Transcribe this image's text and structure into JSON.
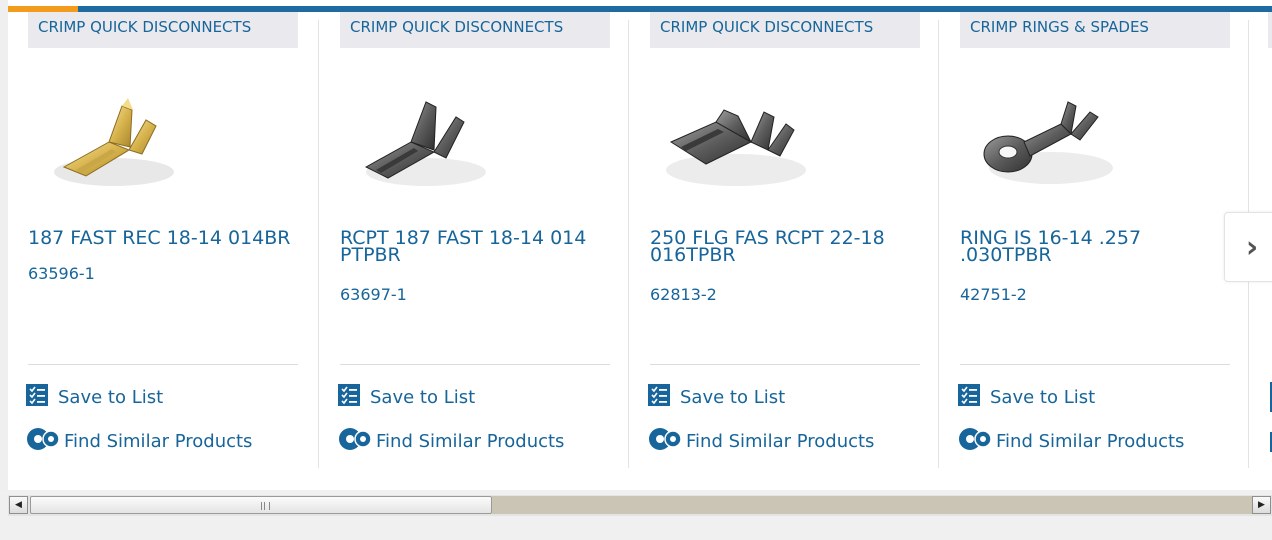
{
  "cards": [
    {
      "category": "CRIMP QUICK DISCONNECTS",
      "title": "187 FAST REC 18-14 014BR",
      "part_number": "63596-1",
      "image_icon": "brass-quick-disconnect-terminal-image",
      "save_label": "Save to List",
      "find_label": "Find Similar Products"
    },
    {
      "category": "CRIMP QUICK DISCONNECTS",
      "title": "RCPT 187 FAST 18-14 014 PTPBR",
      "part_number": "63697-1",
      "image_icon": "dark-quick-disconnect-terminal-image",
      "save_label": "Save to List",
      "find_label": "Find Similar Products"
    },
    {
      "category": "CRIMP QUICK DISCONNECTS",
      "title": "250 FLG FAS RCPT 22-18 016TPBR",
      "part_number": "62813-2",
      "image_icon": "flag-quick-disconnect-terminal-image",
      "save_label": "Save to List",
      "find_label": "Find Similar Products"
    },
    {
      "category": "CRIMP RINGS & SPADES",
      "title": "RING IS 16-14 .257 .030TPBR",
      "part_number": "42751-2",
      "image_icon": "ring-terminal-image",
      "save_label": "Save to List",
      "find_label": "Find Similar Products"
    }
  ],
  "next_button": "›",
  "colors": {
    "brand_blue": "#17659a",
    "accent_orange": "#f29b1d",
    "top_bar": "#1e6aa1"
  },
  "icons": {
    "save": "checklist-icon",
    "find": "gears-icon",
    "next": "chevron-right-icon"
  },
  "scrollbar": {
    "left_arrow": "◀",
    "right_arrow": "▶"
  }
}
